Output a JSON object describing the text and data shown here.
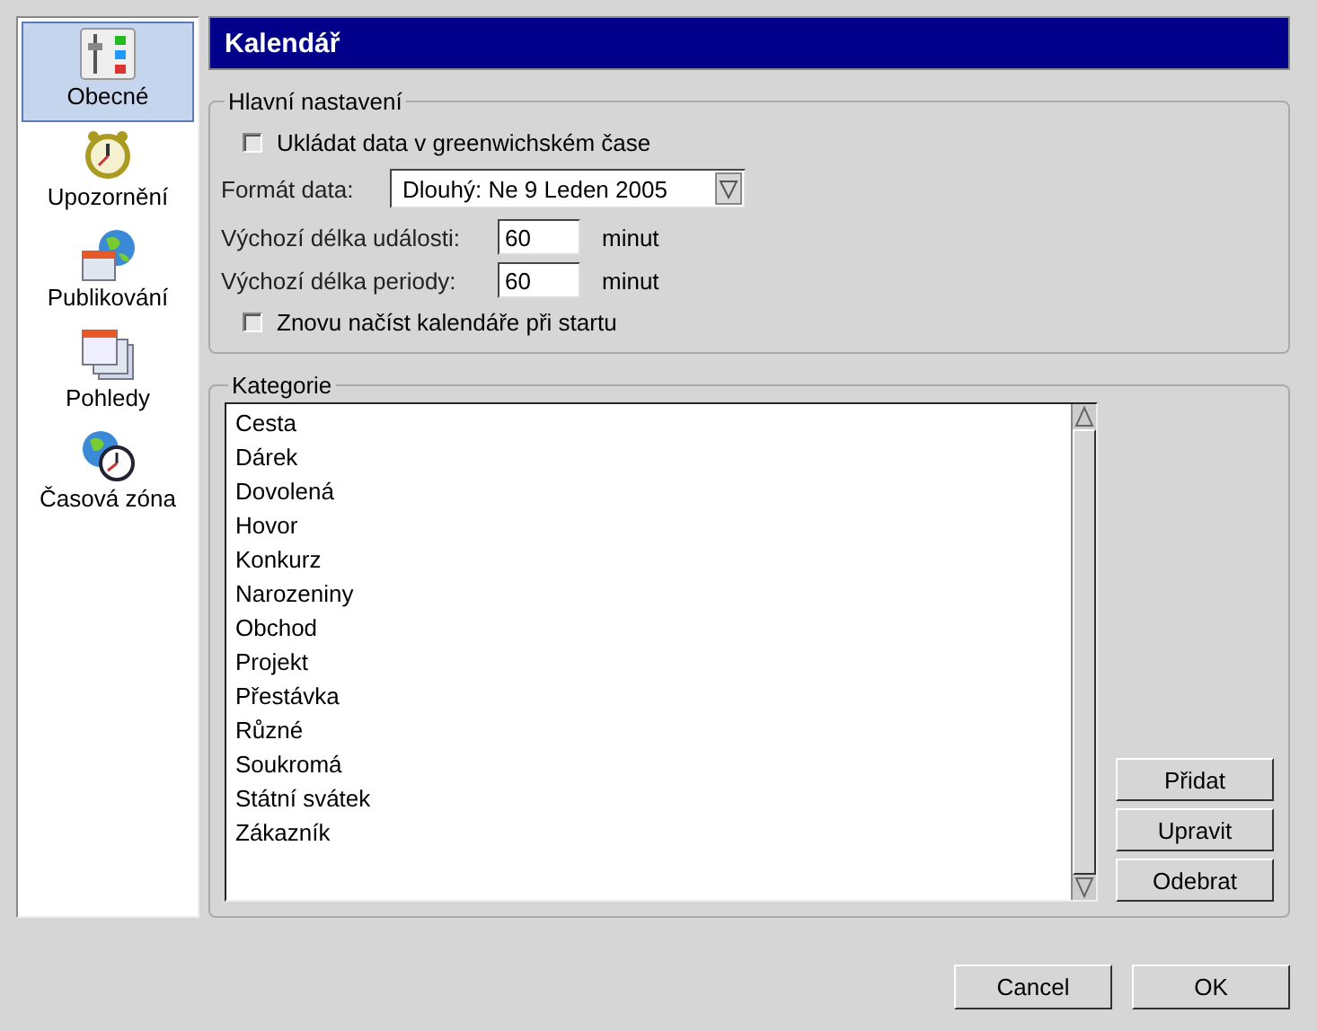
{
  "sidebar": {
    "items": [
      {
        "label": "Obecné",
        "kind": "sliders",
        "selected": true
      },
      {
        "label": "Upozornění",
        "kind": "alarm",
        "selected": false
      },
      {
        "label": "Publikování",
        "kind": "globe-calendar",
        "selected": false
      },
      {
        "label": "Pohledy",
        "kind": "calendars",
        "selected": false
      },
      {
        "label": "Časová zóna",
        "kind": "globe-clock",
        "selected": false
      }
    ]
  },
  "title": "Kalendář",
  "main_settings": {
    "title": "Hlavní nastavení",
    "rows": [
      {
        "kind": "checkbox",
        "label": "Ukládat data v greenwichském čase",
        "checked": false
      },
      {
        "kind": "dropdown",
        "label": "Formát data:",
        "value": "Dlouhý: Ne 9 Leden 2005"
      },
      {
        "kind": "number",
        "label": "Výchozí délka události:",
        "value": "60",
        "unit": "minut"
      },
      {
        "kind": "number",
        "label": "Výchozí délka periody:",
        "value": "60",
        "unit": "minut"
      },
      {
        "kind": "checkbox",
        "label": "Znovu načíst kalendáře při startu",
        "checked": false
      }
    ]
  },
  "categories": {
    "title": "Kategorie",
    "items": [
      "Cesta",
      "Dárek",
      "Dovolená",
      "Hovor",
      "Konkurz",
      "Narozeniny",
      "Obchod",
      "Projekt",
      "Přestávka",
      "Různé",
      "Soukromá",
      "Státní svátek",
      "Zákazník"
    ],
    "buttons": [
      "Přidat",
      "Upravit",
      "Odebrat"
    ]
  },
  "buttons": [
    "Cancel",
    "OK"
  ]
}
